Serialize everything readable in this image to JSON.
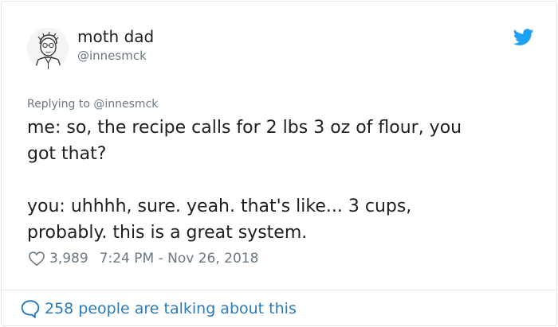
{
  "user": {
    "name": "moth dad",
    "handle": "@innesmck"
  },
  "reply": {
    "prefix": "Replying to",
    "mention": "@innesmck"
  },
  "tweet": {
    "lines": [
      "me: so, the recipe calls for 2 lbs 3 oz of flour, you",
      "got that?",
      "you: uhhhh, sure. yeah. that's like... 3 cups,",
      "probably. this is a great system."
    ]
  },
  "meta": {
    "likes": "3,989",
    "timestamp": "7:24 PM - Nov 26, 2018"
  },
  "footer": {
    "talking": "258 people are talking about this"
  },
  "colors": {
    "link": "#2b7bb9",
    "muted": "#697882",
    "twitter_blue": "#1da1f2",
    "border": "#e1e8ed"
  },
  "icons": [
    "avatar-sketch",
    "twitter-bird-icon",
    "heart-icon",
    "speech-bubble-icon"
  ]
}
